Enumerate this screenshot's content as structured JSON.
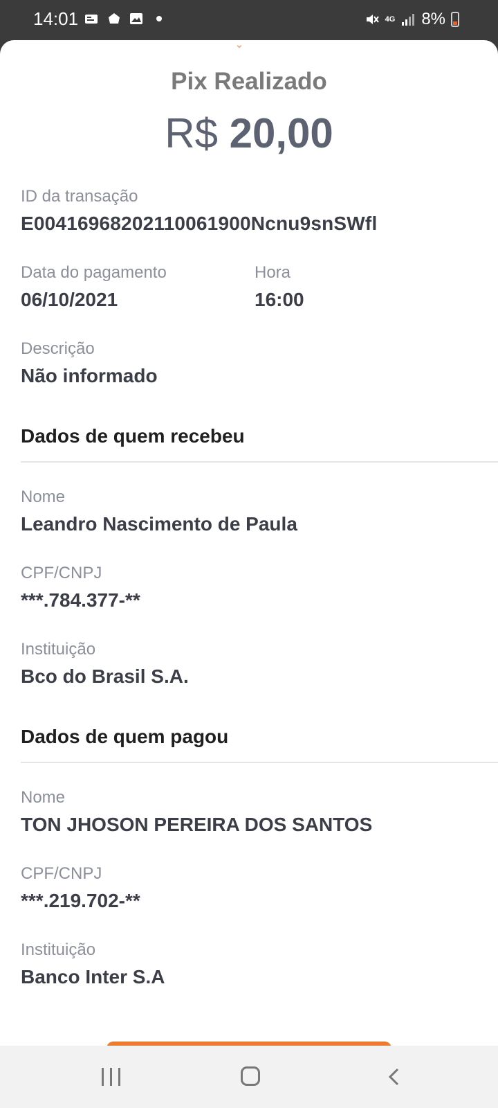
{
  "status_bar": {
    "time": "14:01",
    "network": "4G",
    "battery": "8%",
    "icons": [
      "notification-icon",
      "notification-icon",
      "image-icon",
      "dot-icon",
      "mute-icon",
      "signal-icon",
      "battery-icon"
    ]
  },
  "receipt": {
    "title": "Pix Realizado",
    "currency": "R$",
    "amount": "20,00",
    "transaction_id_label": "ID da transação",
    "transaction_id": "E00416968202110061900Ncnu9snSWfl",
    "payment_date_label": "Data do pagamento",
    "payment_date": "06/10/2021",
    "time_label": "Hora",
    "time": "16:00",
    "description_label": "Descrição",
    "description": "Não informado"
  },
  "recipient": {
    "section_title": "Dados de quem recebeu",
    "name_label": "Nome",
    "name": "Leandro Nascimento de Paula",
    "doc_label": "CPF/CNPJ",
    "doc": "***.784.377-**",
    "institution_label": "Instituição",
    "institution": "Bco do Brasil S.A."
  },
  "payer": {
    "section_title": "Dados de quem pagou",
    "name_label": "Nome",
    "name": "TON JHOSON PEREIRA DOS SANTOS",
    "doc_label": "CPF/CNPJ",
    "doc": "***.219.702-**",
    "institution_label": "Instituição",
    "institution": "Banco Inter S.A"
  },
  "colors": {
    "accent": "#ec7a2f",
    "label": "#8b8f99",
    "value": "#3b3e47"
  }
}
